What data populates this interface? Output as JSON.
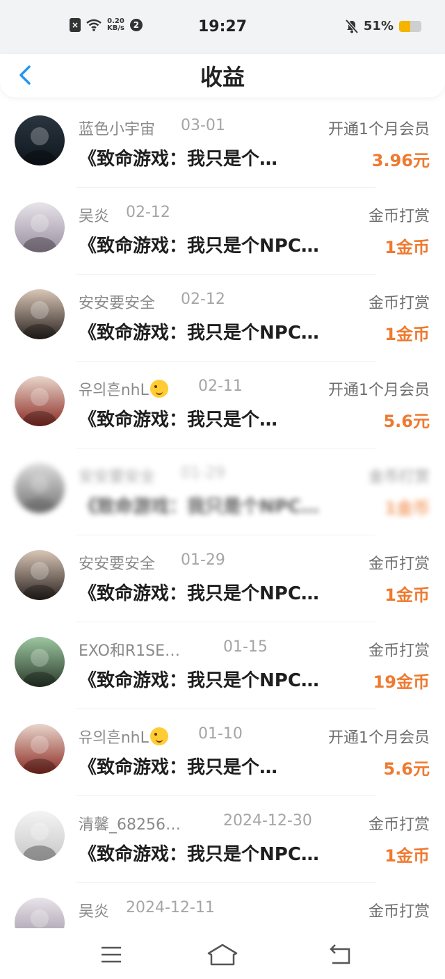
{
  "status_bar": {
    "speed": "0.20\nKB/s",
    "badge": "2",
    "time": "19:27",
    "battery": "51%",
    "battery_level": 0.51
  },
  "header": {
    "title": "收益"
  },
  "items": [
    {
      "name": "蓝色小宇宙",
      "date": "03-01",
      "type": "开通1个月会员",
      "work": "《致命游戏：我只是个…",
      "amount": "3.96元",
      "avatar_colors": [
        "#2a3540",
        "#0f151c"
      ]
    },
    {
      "name": "吴炎",
      "date": "02-12",
      "type": "金币打赏",
      "work": "《致命游戏：我只是个NPC…",
      "amount": "1金币",
      "avatar_colors": [
        "#e8e4ea",
        "#9a8ea0"
      ]
    },
    {
      "name": "安安要安全",
      "date": "02-12",
      "type": "金币打赏",
      "work": "《致命游戏：我只是个NPC…",
      "amount": "1金币",
      "avatar_colors": [
        "#d9c6b6",
        "#2a2320"
      ]
    },
    {
      "name": "유의흔nhL",
      "date": "02-11",
      "type": "开通1个月会员",
      "work": "《致命游戏：我只是个…",
      "amount": "5.6元",
      "avatar_colors": [
        "#e8d6cc",
        "#8c2a22"
      ],
      "emoji": true
    },
    {
      "name": "安安要安全",
      "date": "01-29",
      "type": "金币打赏",
      "work": "《致命游戏：我只是个NPC…",
      "amount": "1金币",
      "avatar_colors": [
        "#cfcfcf",
        "#3a3a3a"
      ],
      "blurred": true
    },
    {
      "name": "安安要安全",
      "date": "01-29",
      "type": "金币打赏",
      "work": "《致命游戏：我只是个NPC…",
      "amount": "1金币",
      "avatar_colors": [
        "#d9c6b6",
        "#2a2320"
      ]
    },
    {
      "name": "EXO和R1SE…",
      "date": "01-15",
      "type": "金币打赏",
      "work": "《致命游戏：我只是个NPC…",
      "amount": "19金币",
      "avatar_colors": [
        "#9cc7a0",
        "#2c3a2c"
      ]
    },
    {
      "name": "유의흔nhL",
      "date": "01-10",
      "type": "开通1个月会员",
      "work": "《致命游戏：我只是个…",
      "amount": "5.6元",
      "avatar_colors": [
        "#e8d6cc",
        "#8c2a22"
      ],
      "emoji": true
    },
    {
      "name": "清馨_68256…",
      "date": "2024-12-30",
      "type": "金币打赏",
      "work": "《致命游戏：我只是个NPC…",
      "amount": "1金币",
      "avatar_colors": [
        "#f4f4f4",
        "#c8c8c8"
      ]
    },
    {
      "name": "吴炎",
      "date": "2024-12-11",
      "type": "金币打赏",
      "work": "",
      "amount": "",
      "avatar_colors": [
        "#e8e4ea",
        "#9a8ea0"
      ]
    }
  ],
  "colors": {
    "accent": "#2196f3",
    "amount": "#ee7a30"
  },
  "nav": [
    "menu-icon",
    "home-icon",
    "back-icon"
  ]
}
